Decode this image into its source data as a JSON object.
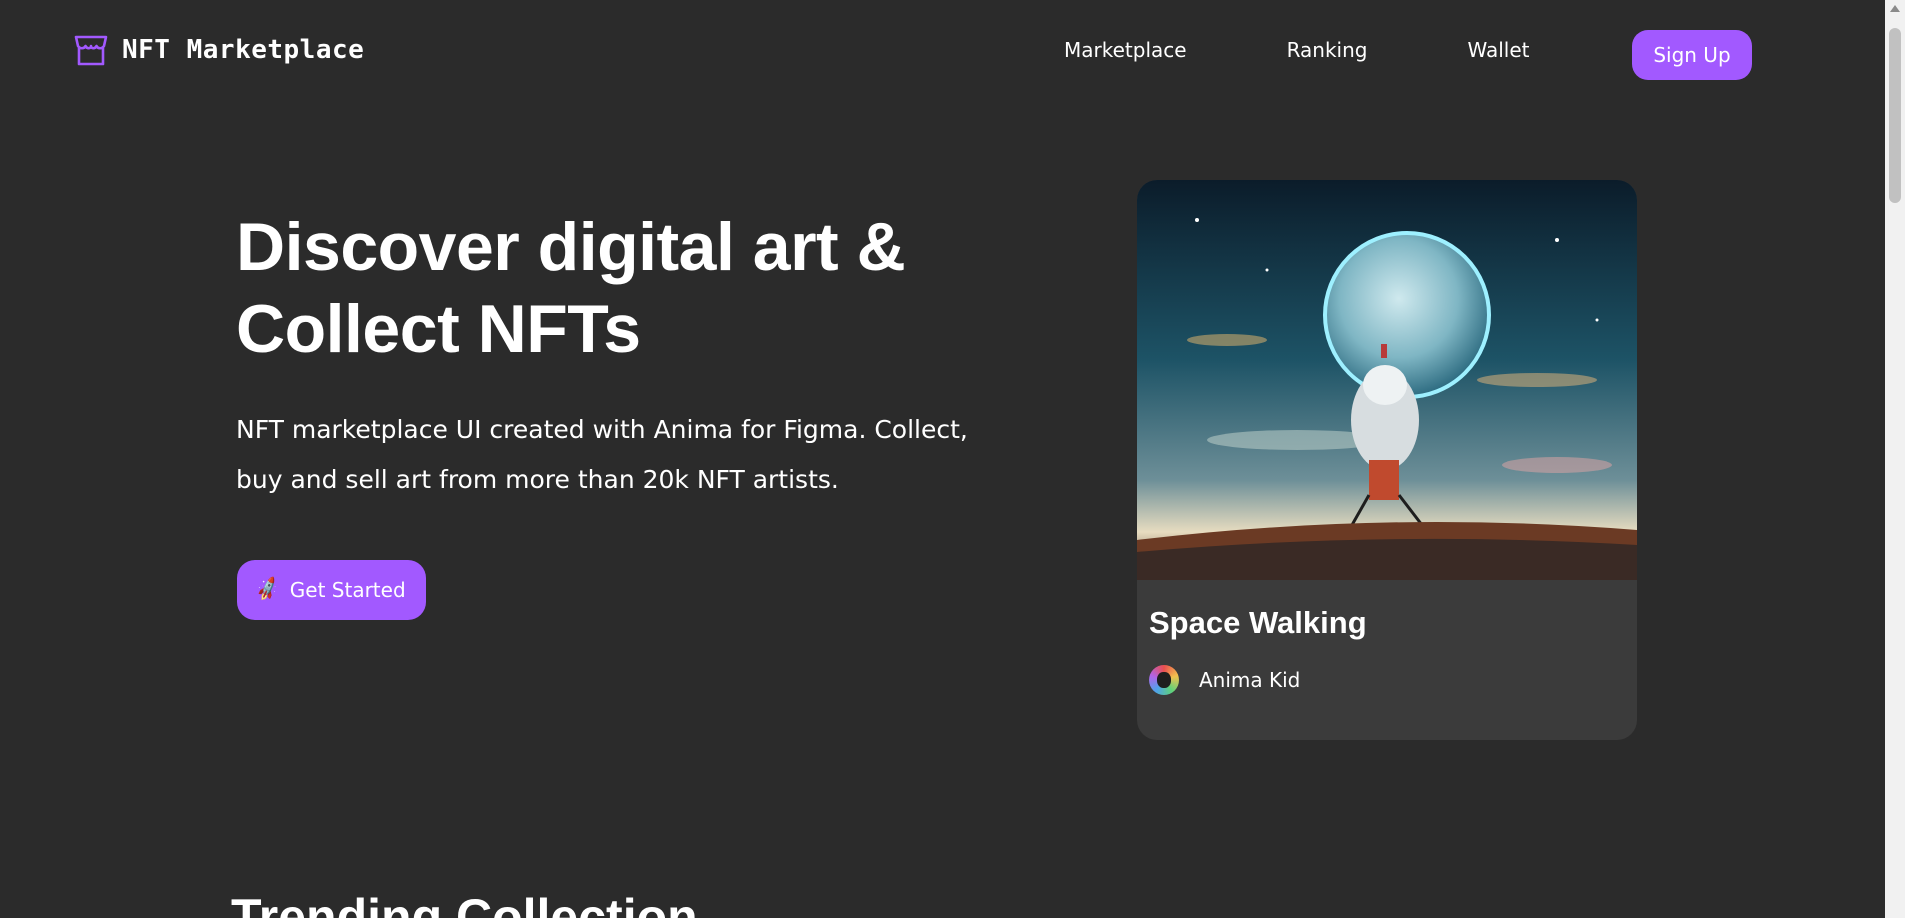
{
  "brand": {
    "name": "NFT Marketplace",
    "icon": "storefront-icon",
    "accent_color": "#a259ff"
  },
  "nav": {
    "links": [
      "Marketplace",
      "Ranking",
      "Wallet"
    ],
    "signup_label": "Sign Up"
  },
  "hero": {
    "title_line1": "Discover digital art &",
    "title_line2": "Collect NFTs",
    "description_line1": "NFT marketplace UI created with Anima for Figma. Collect,",
    "description_line2": "buy and sell art from more than 20k NFT artists.",
    "cta_label": "Get Started",
    "cta_icon": "rocket-icon"
  },
  "featured": {
    "title": "Space Walking",
    "artist": "Anima Kid",
    "image": "astronaut-planet-artwork"
  },
  "trending": {
    "title": "Trending Collection"
  },
  "colors": {
    "background": "#2b2b2b",
    "card": "#3b3b3b",
    "text": "#ffffff"
  }
}
